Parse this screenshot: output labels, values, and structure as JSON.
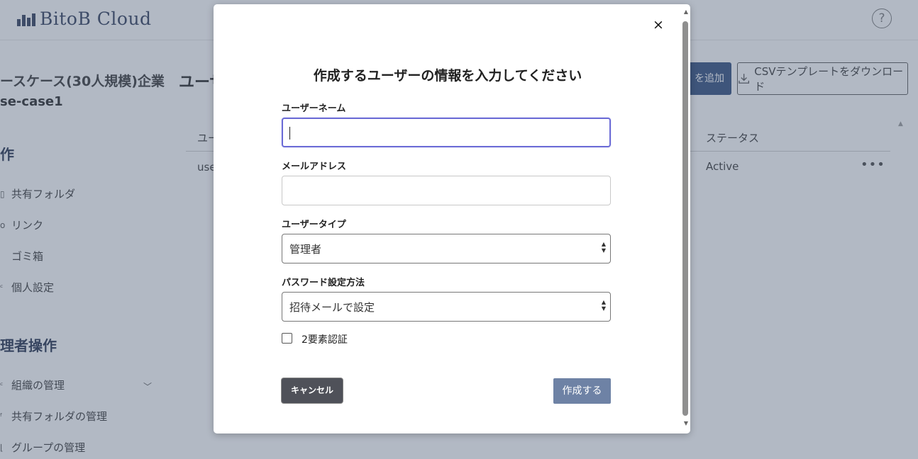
{
  "app": {
    "logo_text": "BitoB Cloud",
    "help_icon": "?"
  },
  "sidebar": {
    "company": "ースケース(30人規模)企業",
    "company_id": "se-case1",
    "section_user": "作",
    "items_user": [
      {
        "icon": "folder-icon",
        "label": "共有フォルダ"
      },
      {
        "icon": "link-icon",
        "label": "リンク"
      },
      {
        "icon": "trash-icon",
        "label": "ゴミ箱"
      },
      {
        "icon": "person-icon",
        "label": "個人設定"
      }
    ],
    "section_admin": "理者操作",
    "items_admin": [
      {
        "icon": "org-icon",
        "label": "組織の管理"
      },
      {
        "icon": "shared-folder-icon",
        "label": "共有フォルダの管理"
      },
      {
        "icon": "group-icon",
        "label": "グループの管理"
      }
    ]
  },
  "main": {
    "title": "ユーザ",
    "add_button": "を追加",
    "csv_button": "CSVテンプレートをダウンロード",
    "table": {
      "col_user": "ユー",
      "col_status": "ステータス",
      "rows": [
        {
          "user": "use",
          "status": "Active",
          "more": "•••"
        }
      ]
    }
  },
  "modal": {
    "title": "作成するユーザーの情報を入力してください",
    "close_label": "×",
    "username_label": "ユーザーネーム",
    "username_value": "",
    "email_label": "メールアドレス",
    "email_value": "",
    "usertype_label": "ユーザータイプ",
    "usertype_value": "管理者",
    "password_label": "パスワード設定方法",
    "password_value": "招待メールで設定",
    "two_factor_label": "2要素認証",
    "two_factor_checked": false,
    "cancel_button": "キャンセル",
    "create_button": "作成する"
  },
  "colors": {
    "brand": "#2d3a58",
    "focus": "#6b6bd6",
    "primary_button": "#6e82a5",
    "cancel_button": "#4f5159"
  }
}
